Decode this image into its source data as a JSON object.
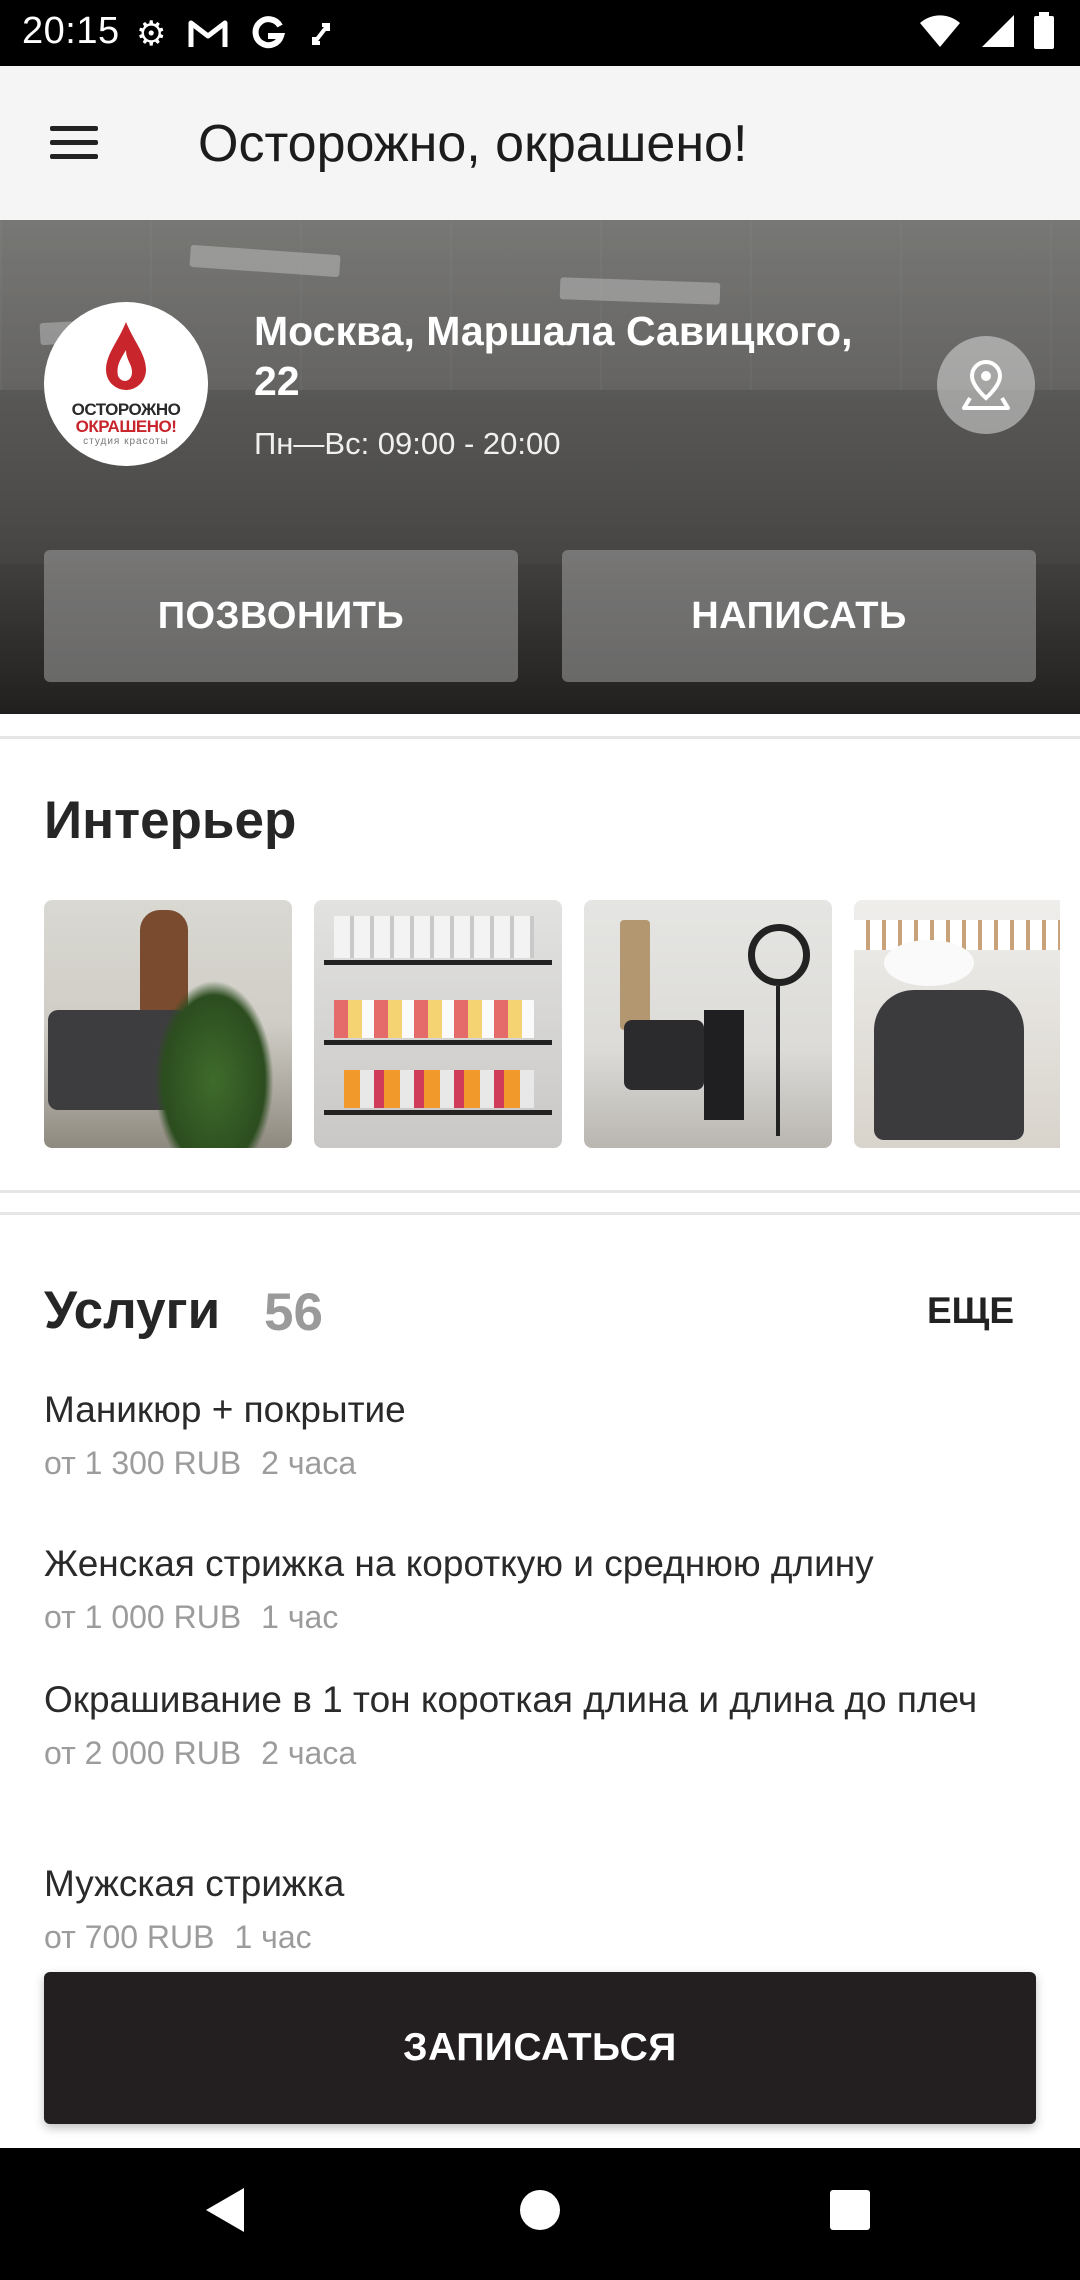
{
  "status_bar": {
    "time": "20:15",
    "left_icons": [
      "settings-icon",
      "gmail-icon",
      "google-icon",
      "transfer-icon"
    ],
    "right_icons": [
      "wifi-icon",
      "signal-icon",
      "battery-icon"
    ]
  },
  "app_bar": {
    "title": "Осторожно, окрашено!",
    "menu_icon": "menu-icon"
  },
  "hero": {
    "logo": {
      "line1": "ОСТОРОЖНО",
      "line2": "ОКРАШЕНО!",
      "line3": "студия красоты"
    },
    "address": "Москва, Маршала Савицкого, 22",
    "hours": "Пн—Вс: 09:00 - 20:00",
    "map_icon": "map-pin-icon",
    "call_label": "ПОЗВОНИТЬ",
    "write_label": "НАПИСАТЬ"
  },
  "interior": {
    "title": "Интерьер",
    "photos": [
      "lounge-photo",
      "shelf-photo",
      "workstation-photo",
      "wash-station-photo"
    ]
  },
  "services": {
    "title": "Услуги",
    "count": "56",
    "more_label": "ЕЩЕ",
    "items": [
      {
        "name": "Маникюр + покрытие",
        "price": "от 1 300 RUB",
        "duration": "2 часа"
      },
      {
        "name": "Женская стрижка на короткую и среднюю длину",
        "price": "от 1 000 RUB",
        "duration": "1 час"
      },
      {
        "name": "Окрашивание в 1 тон короткая длина и длина до плеч",
        "price": "от 2 000 RUB",
        "duration": "2 часа"
      },
      {
        "name": "Мужская стрижка",
        "price": "от 700 RUB",
        "duration": "1 час"
      }
    ]
  },
  "book_label": "ЗАПИСАТЬСЯ",
  "nav_bar": {
    "icons": [
      "back-icon",
      "home-icon",
      "recents-icon"
    ]
  },
  "colors": {
    "brand_red": "#c8262c",
    "book_button": "#231f20",
    "muted_text": "#9c9c9c"
  }
}
